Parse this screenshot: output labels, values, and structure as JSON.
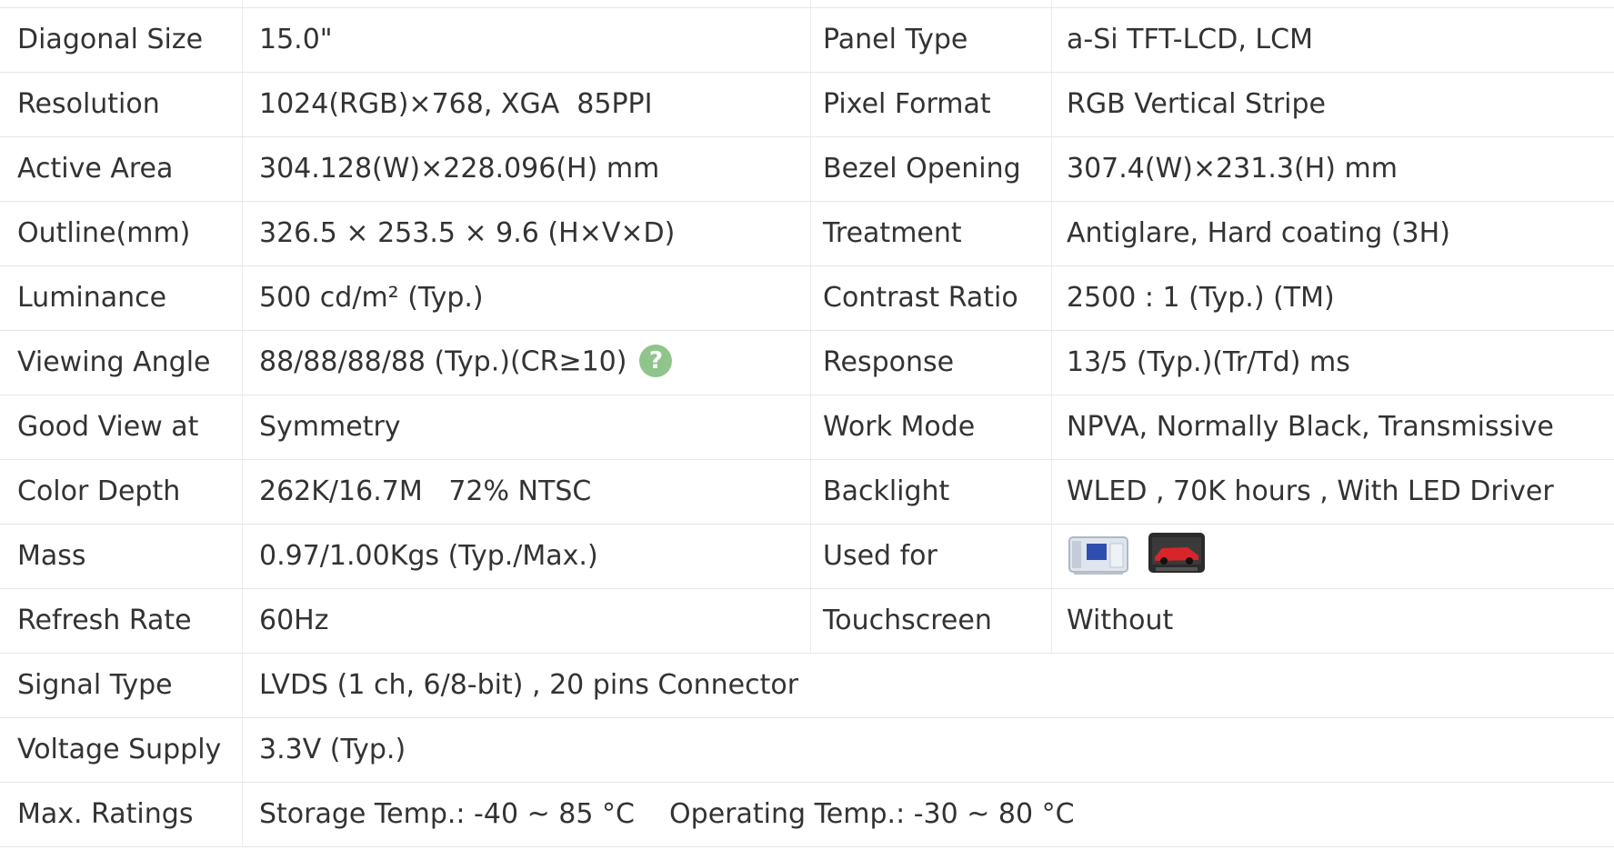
{
  "rows": [
    {
      "label": "Diagonal Size",
      "value": "15.0\"",
      "label2": "Panel Type",
      "value2": "a-Si TFT-LCD, LCM"
    },
    {
      "label": "Resolution",
      "value": "1024(RGB)×768, XGA  85PPI",
      "label2": "Pixel Format",
      "value2": "RGB Vertical Stripe"
    },
    {
      "label": "Active Area",
      "value": "304.128(W)×228.096(H) mm",
      "label2": "Bezel Opening",
      "value2": "307.4(W)×231.3(H) mm"
    },
    {
      "label": "Outline(mm)",
      "value": "326.5 × 253.5 × 9.6 (H×V×D)",
      "label2": "Treatment",
      "value2": "Antiglare, Hard coating (3H)"
    },
    {
      "label": "Luminance",
      "value": "500 cd/m² (Typ.)",
      "label2": "Contrast Ratio",
      "value2": "2500 : 1 (Typ.) (TM)"
    },
    {
      "label": "Viewing Angle",
      "value": "88/88/88/88 (Typ.)(CR≥10)",
      "label2": "Response",
      "value2": "13/5 (Typ.)(Tr/Td) ms"
    },
    {
      "label": "Good View at",
      "value": "Symmetry",
      "label2": "Work Mode",
      "value2": "NPVA, Normally Black, Transmissive"
    },
    {
      "label": "Color Depth",
      "value": "262K/16.7M   72% NTSC",
      "label2": "Backlight",
      "value2": "WLED , 70K hours , With LED Driver"
    },
    {
      "label": "Mass",
      "value": "0.97/1.00Kgs (Typ./Max.)",
      "label2": "Used for",
      "value2_icons": [
        "industrial-device-icon",
        "car-display-icon"
      ]
    },
    {
      "label": "Refresh Rate",
      "value": "60Hz",
      "label2": "Touchscreen",
      "value2": "Without"
    },
    {
      "label": "Signal Type",
      "value": "LVDS (1 ch, 6/8-bit) , 20 pins Connector"
    },
    {
      "label": "Voltage Supply",
      "value": "3.3V (Typ.)"
    },
    {
      "label": "Max. Ratings",
      "value": "Storage Temp.: -40 ~ 85 °C    Operating Temp.: -30 ~ 80 °C"
    }
  ],
  "help_icon_glyph": "?",
  "colors": {
    "text": "#333333",
    "border": "#e6e6e6",
    "help_icon": "#8fc48a"
  }
}
